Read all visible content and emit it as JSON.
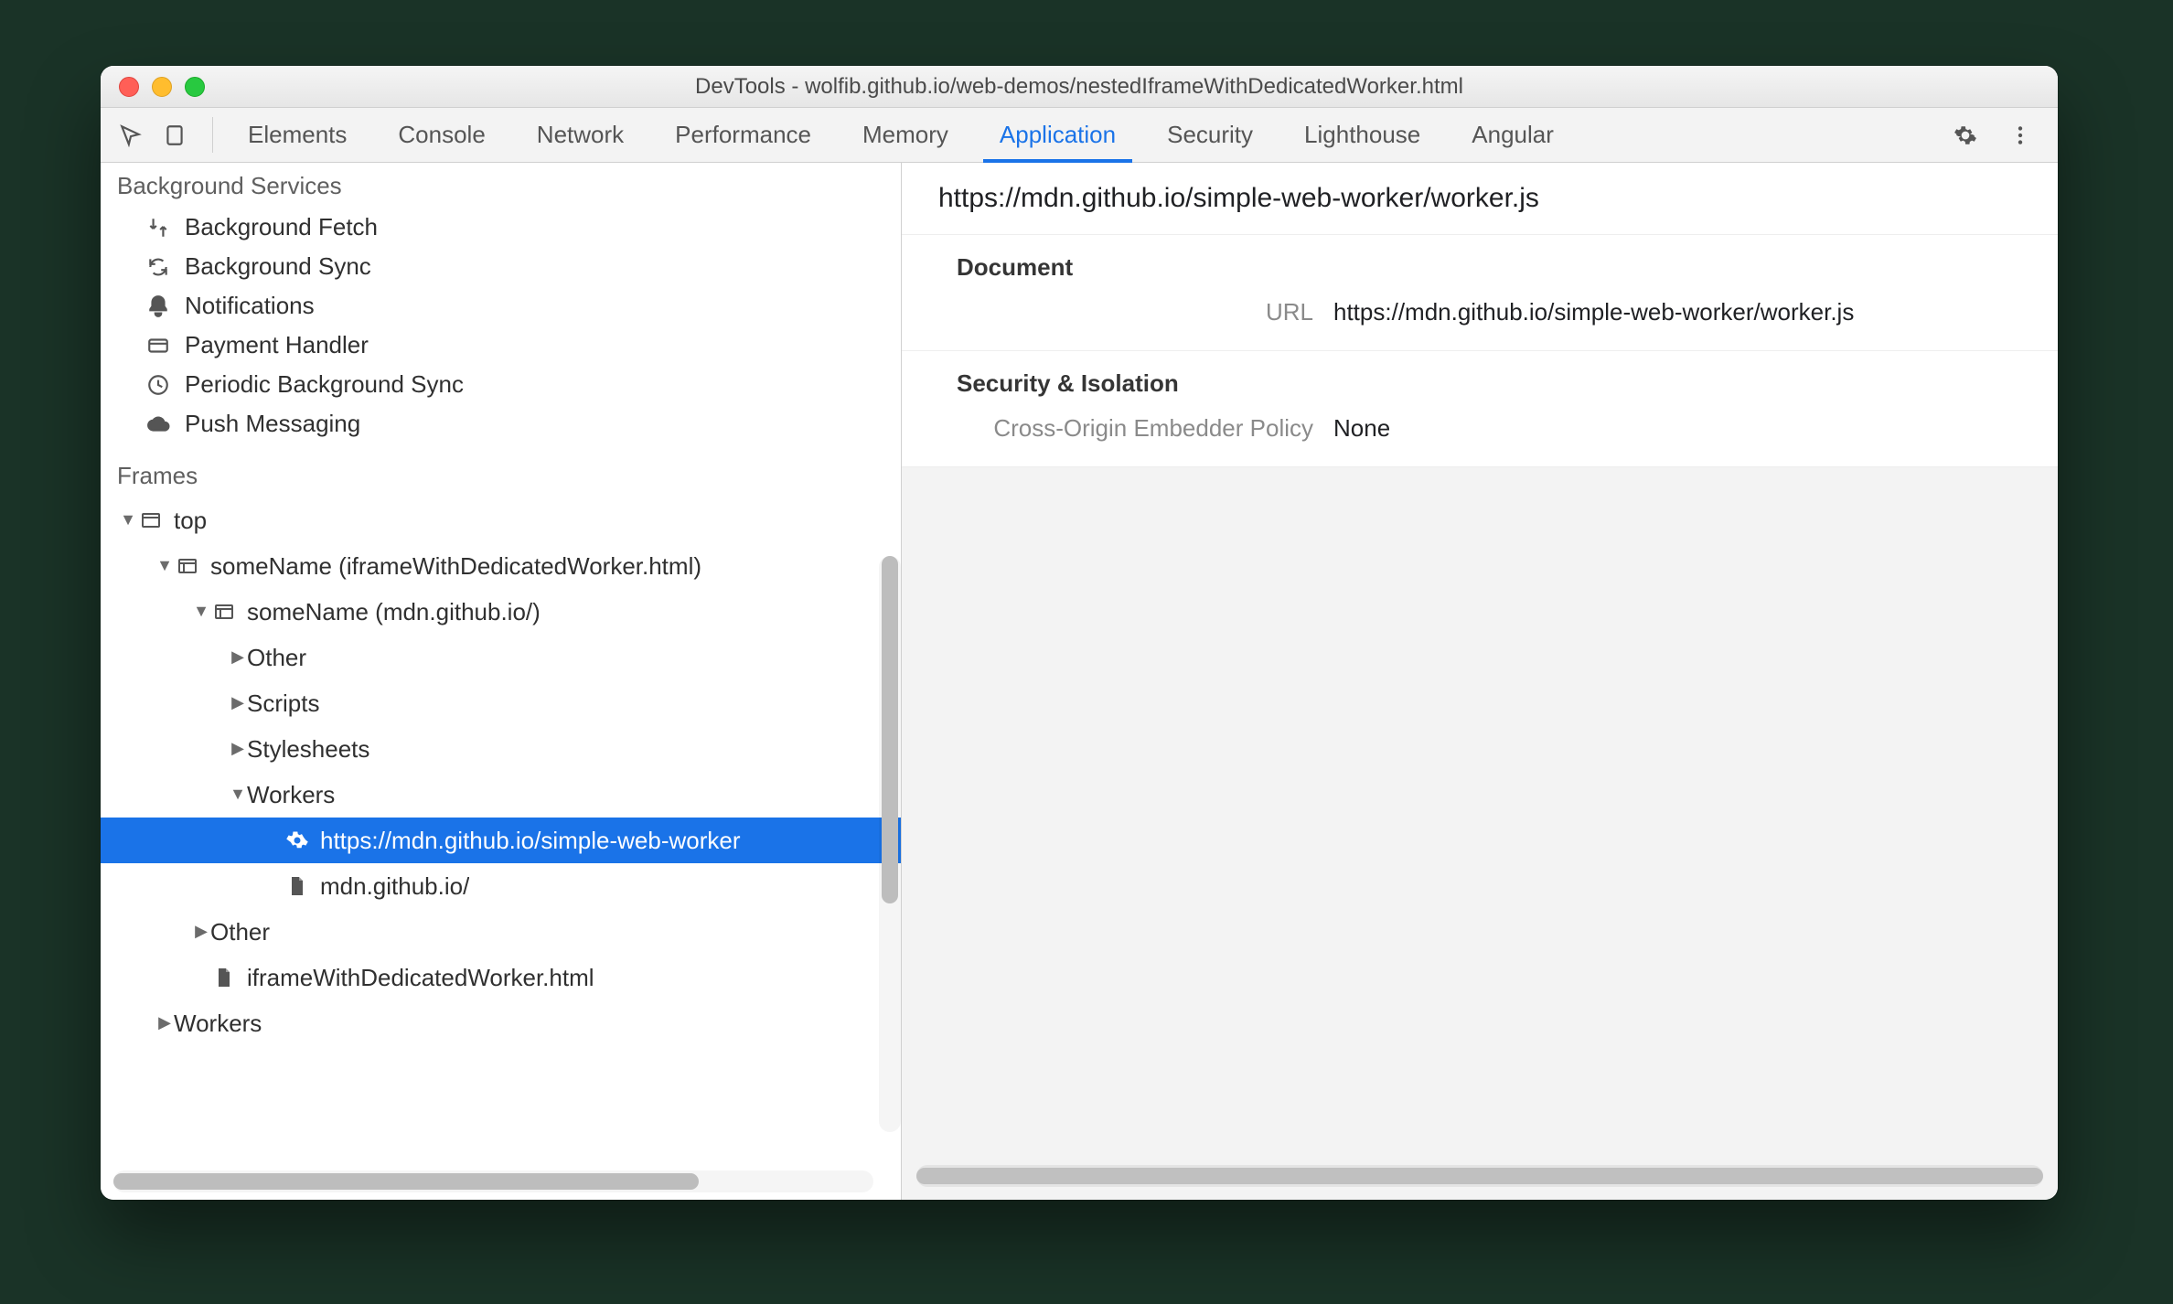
{
  "window": {
    "title": "DevTools - wolfib.github.io/web-demos/nestedIframeWithDedicatedWorker.html"
  },
  "tabs": {
    "items": [
      "Elements",
      "Console",
      "Network",
      "Performance",
      "Memory",
      "Application",
      "Security",
      "Lighthouse",
      "Angular"
    ],
    "active": "Application"
  },
  "sidebar": {
    "bg_services_title": "Background Services",
    "bg_services": [
      {
        "icon": "fetch-icon",
        "label": "Background Fetch"
      },
      {
        "icon": "sync-icon",
        "label": "Background Sync"
      },
      {
        "icon": "bell-icon",
        "label": "Notifications"
      },
      {
        "icon": "card-icon",
        "label": "Payment Handler"
      },
      {
        "icon": "clock-icon",
        "label": "Periodic Background Sync"
      },
      {
        "icon": "cloud-icon",
        "label": "Push Messaging"
      }
    ],
    "frames_title": "Frames",
    "tree": [
      {
        "depth": 0,
        "arrow": "expanded",
        "icon": "window-icon",
        "label": "top"
      },
      {
        "depth": 1,
        "arrow": "expanded",
        "icon": "frame-icon",
        "label": "someName (iframeWithDedicatedWorker.html)"
      },
      {
        "depth": 2,
        "arrow": "expanded",
        "icon": "frame-icon",
        "label": "someName (mdn.github.io/)"
      },
      {
        "depth": 3,
        "arrow": "collapsed",
        "icon": "",
        "label": "Other"
      },
      {
        "depth": 3,
        "arrow": "collapsed",
        "icon": "",
        "label": "Scripts"
      },
      {
        "depth": 3,
        "arrow": "collapsed",
        "icon": "",
        "label": "Stylesheets"
      },
      {
        "depth": 3,
        "arrow": "expanded",
        "icon": "",
        "label": "Workers"
      },
      {
        "depth": 4,
        "arrow": "none",
        "icon": "gear-icon",
        "label": "https://mdn.github.io/simple-web-worker",
        "selected": true
      },
      {
        "depth": 4,
        "arrow": "none",
        "icon": "file-icon",
        "label": "mdn.github.io/"
      },
      {
        "depth": 2,
        "arrow": "collapsed",
        "icon": "",
        "label": "Other"
      },
      {
        "depth": 2,
        "arrow": "none",
        "icon": "file-icon",
        "label": "iframeWithDedicatedWorker.html"
      },
      {
        "depth": 1,
        "arrow": "collapsed",
        "icon": "",
        "label": "Workers"
      }
    ]
  },
  "main": {
    "header": "https://mdn.github.io/simple-web-worker/worker.js",
    "sections": [
      {
        "title": "Document",
        "rows": [
          {
            "k": "URL",
            "v": "https://mdn.github.io/simple-web-worker/worker.js"
          }
        ]
      },
      {
        "title": "Security & Isolation",
        "rows": [
          {
            "k": "Cross-Origin Embedder Policy",
            "v": "None"
          }
        ]
      }
    ]
  }
}
